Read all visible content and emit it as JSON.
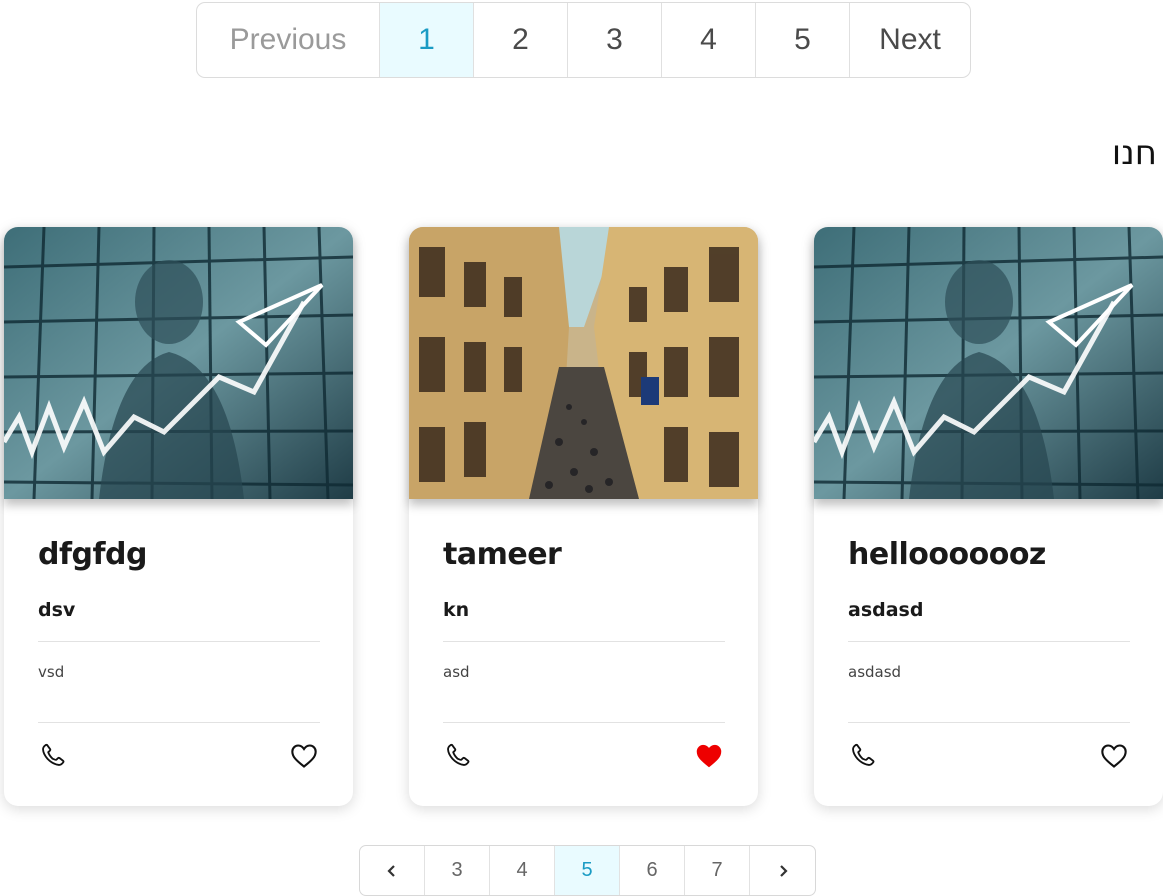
{
  "pagination_top": {
    "previous_label": "Previous",
    "pages": [
      "1",
      "2",
      "3",
      "4",
      "5"
    ],
    "active_page": "1",
    "next_label": "Next"
  },
  "section": {
    "title": "חנו"
  },
  "cards": [
    {
      "title": "dfgfdg",
      "subtitle": "dsv",
      "description": "vsd",
      "image": "stock-chart-man",
      "favorited": false
    },
    {
      "title": "tameer",
      "subtitle": "kn",
      "description": "asd",
      "image": "street-buildings",
      "favorited": true
    },
    {
      "title": "hellooooooz",
      "subtitle": "asdasd",
      "description": "asdasd",
      "image": "stock-chart-man",
      "favorited": false
    }
  ],
  "pagination_bottom": {
    "prev_icon": "chevron-left-icon",
    "pages": [
      "3",
      "4",
      "5",
      "6",
      "7"
    ],
    "active_page": "5",
    "next_icon": "chevron-right-icon"
  },
  "colors": {
    "active_bg": "#e9fbff",
    "active_text": "#1a9bc4",
    "heart_active": "#ee0000"
  },
  "icons": {
    "call": "phone-icon",
    "favorite": "heart-icon"
  }
}
